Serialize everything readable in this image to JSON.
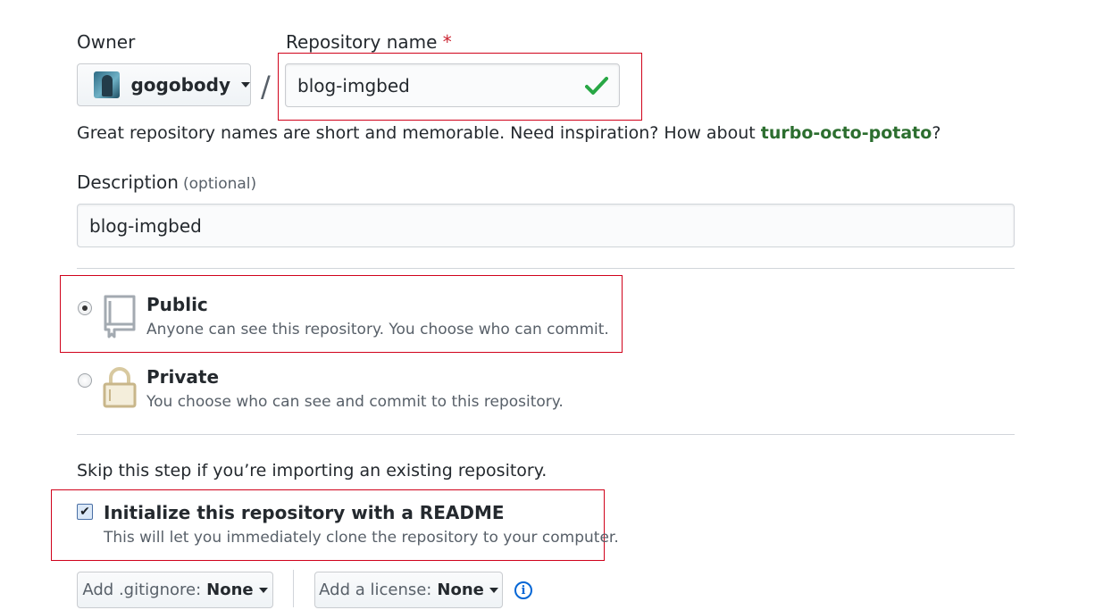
{
  "owner": {
    "label": "Owner",
    "value": "gogobody"
  },
  "repo_name": {
    "label": "Repository name",
    "required_mark": "*",
    "value": "blog-imgbed",
    "valid": true
  },
  "separator": "/",
  "name_hint": {
    "prefix": "Great repository names are short and memorable. Need inspiration? How about ",
    "suggestion": "turbo-octo-potato",
    "suffix": "?"
  },
  "description": {
    "label": "Description",
    "optional": "(optional)",
    "value": "blog-imgbed"
  },
  "visibility": {
    "selected": "public",
    "options": [
      {
        "id": "public",
        "title": "Public",
        "desc": "Anyone can see this repository. You choose who can commit."
      },
      {
        "id": "private",
        "title": "Private",
        "desc": "You choose who can see and commit to this repository."
      }
    ]
  },
  "init": {
    "skip_text": "Skip this step if you’re importing an existing repository.",
    "readme_title": "Initialize this repository with a README",
    "readme_desc": "This will let you immediately clone the repository to your computer.",
    "readme_checked": true
  },
  "gitignore": {
    "label": "Add .gitignore:",
    "value": "None"
  },
  "license": {
    "label": "Add a license:",
    "value": "None"
  },
  "colors": {
    "highlight_box": "#d0021b",
    "valid_check": "#28a745",
    "link_green": "#2c6e2f",
    "info_blue": "#0366d6"
  }
}
